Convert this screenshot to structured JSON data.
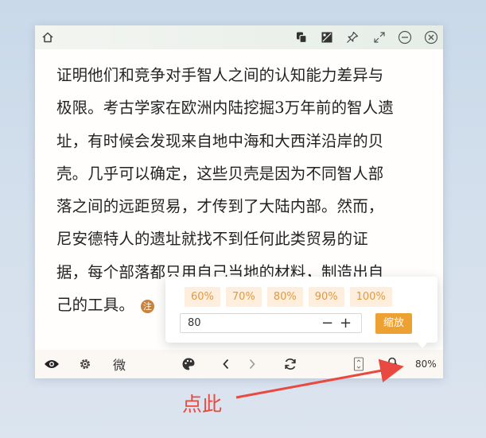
{
  "reader": {
    "lines": [
      "证明他们和竞争对手智人之间的认知能力差异与",
      "极限。考古学家在欧洲内陆挖掘3万年前的智人遗",
      "址，有时候会发现来自地中海和大西洋沿岸的贝",
      "壳。几乎可以确定，这些贝壳是因为不同智人部",
      "落之间的远距贸易，才传到了大陆内部。然而，",
      "尼安德特人的遗址就找不到任何此类贸易的证",
      "据，每个部落都只用自己当地的材料，制造出自",
      "己的工具。"
    ],
    "note_label": "注"
  },
  "toolbar": {
    "wei_label": "微",
    "zoom_display": "80%"
  },
  "zoom_popup": {
    "presets": [
      "60%",
      "70%",
      "80%",
      "90%",
      "100%"
    ],
    "input_value": "80",
    "minus": "−",
    "plus": "+",
    "apply_label": "缩放"
  },
  "annotation": {
    "text": "点此"
  },
  "colors": {
    "accent": "#eea133",
    "chip_bg": "#fdeede",
    "chip_text": "#e09a42",
    "callout": "#e84a42"
  }
}
